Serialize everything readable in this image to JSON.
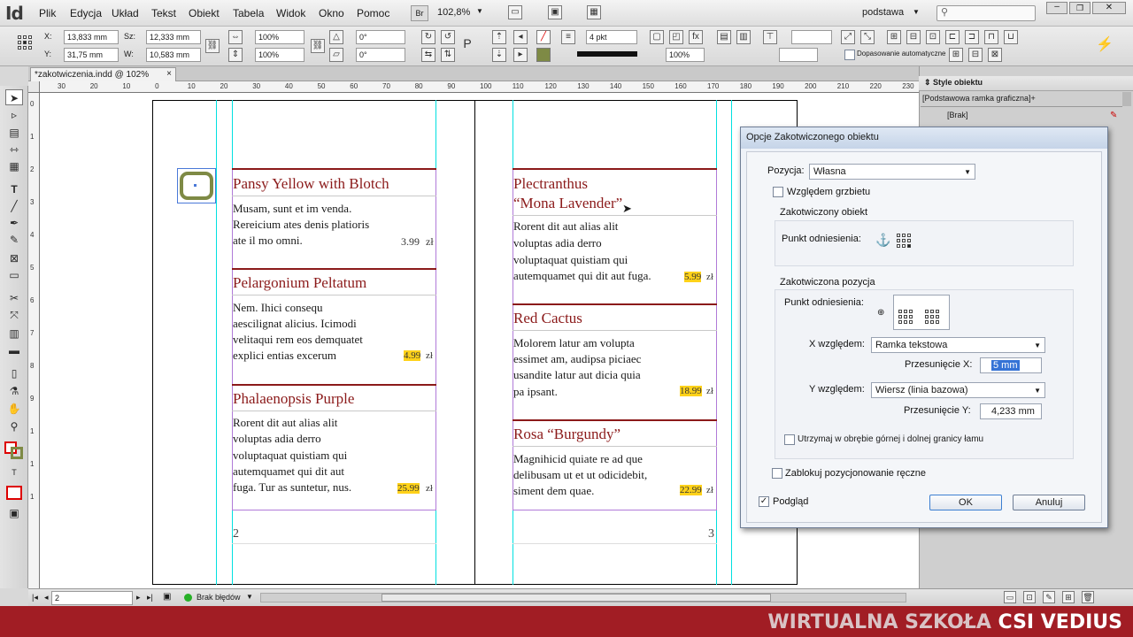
{
  "app": {
    "logo": "Id",
    "zoom": "102,8%",
    "workspace": "podstawa"
  },
  "menu": [
    "Plik",
    "Edycja",
    "Układ",
    "Tekst",
    "Obiekt",
    "Tabela",
    "Widok",
    "Okno",
    "Pomoc"
  ],
  "appbar": {
    "br_label": "Br"
  },
  "control": {
    "x_label": "X:",
    "x_value": "13,833 mm",
    "y_label": "Y:",
    "y_value": "31,75 mm",
    "w_label": "Sz:",
    "w_value": "12,333 mm",
    "h_label": "W:",
    "h_value": "10,583 mm",
    "scale_x": "100%",
    "scale_y": "100%",
    "angle": "0°",
    "shear": "0°",
    "stroke_weight": "4 pkt",
    "opacity": "100%",
    "autofit_label": "Dopasowanie automatyczne"
  },
  "tab": {
    "title": "*zakotwiczenia.indd @ 102%",
    "close": "×"
  },
  "ruler": {
    "h": [
      "30",
      "20",
      "10",
      "0",
      "10",
      "20",
      "30",
      "40",
      "50",
      "60",
      "70",
      "80",
      "90",
      "100",
      "110",
      "120",
      "130",
      "140",
      "150",
      "160",
      "170",
      "180",
      "190",
      "200",
      "210",
      "220",
      "230"
    ],
    "v": [
      "0",
      "1",
      "2",
      "3",
      "4",
      "5",
      "6",
      "7",
      "8",
      "9",
      "1",
      "1",
      "1"
    ]
  },
  "left_page": {
    "items": [
      {
        "title": "Pansy Yellow with Blotch",
        "desc": [
          "Musam, sunt et im venda.",
          "Rereicium ates denis platioris",
          "ate il mo omni."
        ],
        "price": "3.99",
        "currency": "zł",
        "highlight": false
      },
      {
        "title": "Pelargonium Peltatum",
        "desc": [
          "Nem. Ihici consequ",
          "aesciligna­t alicius. Icimodi",
          "velitaqui rem eos demquatet",
          "explici entias excerum"
        ],
        "price": "4.99",
        "currency": "zł",
        "highlight": true
      },
      {
        "title": "Phalaenopsis Purple",
        "desc": [
          "Rorent dit aut alias alit",
          "voluptas adia derro",
          "voluptaquat quistiam qui",
          "autemquamet qui dit aut",
          "fuga. Tur as suntetur, nus."
        ],
        "price": "25.99",
        "currency": "zł",
        "highlight": true
      }
    ],
    "page_number": "2"
  },
  "right_page": {
    "items": [
      {
        "title": "Plectranthus",
        "title2": "“Mona Lavender”",
        "desc": [
          "Rorent dit aut alias alit",
          "voluptas adia derro",
          "voluptaquat quistiam qui",
          "autemquamet qui dit aut fuga."
        ],
        "price": "5.99",
        "currency": "zł",
        "highlight": true
      },
      {
        "title": "Red Cactus",
        "desc": [
          "Molorem latur am volupta",
          "essimet am, audipsa piciaec",
          "usandite latur aut dicia quia",
          "pa ipsant."
        ],
        "price": "18.99",
        "currency": "zł",
        "highlight": true
      },
      {
        "title": "Rosa “Burgundy”",
        "desc": [
          "Magnihicid quiate re ad que",
          "delibusam ut et ut odicidebit,",
          "siment dem quae."
        ],
        "price": "22.99",
        "currency": "zł",
        "highlight": true
      }
    ],
    "page_number": "3"
  },
  "panel": {
    "title": "Style obiektu",
    "subtitle": "[Podstawowa ramka graficzna]+",
    "item": "[Brak]"
  },
  "dialog": {
    "title": "Opcje Zakotwiczonego obiektu",
    "position_label": "Pozycja:",
    "position_value": "Własna",
    "spine_label": "Względem grzbietu",
    "anchored_object_group": "Zakotwiczony obiekt",
    "ref_point_label": "Punkt odniesienia:",
    "anchored_position_group": "Zakotwiczona pozycja",
    "ref_point_label2": "Punkt odniesienia:",
    "x_rel_label": "X względem:",
    "x_rel_value": "Ramka tekstowa",
    "x_offset_label": "Przesunięcie X:",
    "x_offset_value": "5 mm",
    "y_rel_label": "Y względem:",
    "y_rel_value": "Wiersz (linia bazowa)",
    "y_offset_label": "Przesunięcie Y:",
    "y_offset_value": "4,233 mm",
    "keep_within_label": "Utrzymaj w obrębie górnej i dolnej granicy łamu",
    "prevent_manual_label": "Zablokuj pozycjonowanie ręczne",
    "preview_label": "Podgląd",
    "preview_checked": "✓",
    "ok_label": "OK",
    "cancel_label": "Anuluj"
  },
  "status": {
    "page": "2",
    "errors": "Brak błędów"
  },
  "banner": {
    "prefix": "WIRTUALNA SZKOŁA ",
    "brand": "CSI VEDIUS"
  },
  "colors": {
    "title_red": "#8b1a1a",
    "price_highlight": "#ffd21a",
    "guide_cyan": "#00e0e0",
    "banner": "#a11d24"
  }
}
